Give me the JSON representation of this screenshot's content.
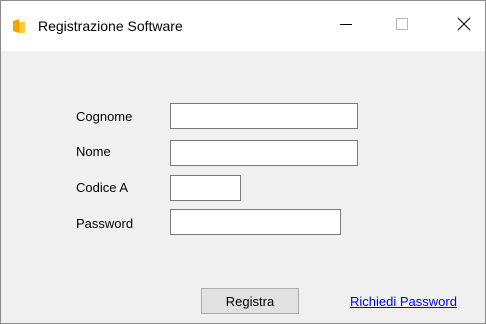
{
  "window": {
    "title": "Registrazione Software",
    "icon": "app-folder-icon",
    "controls": {
      "minimize": "minimize-icon",
      "maximize": "maximize-icon",
      "close": "close-icon"
    }
  },
  "form": {
    "cognome": {
      "label": "Cognome",
      "value": ""
    },
    "nome": {
      "label": "Nome",
      "value": ""
    },
    "codice": {
      "label": "Codice A",
      "value": ""
    },
    "password": {
      "label": "Password",
      "value": ""
    }
  },
  "actions": {
    "register_label": "Registra",
    "request_password_label": "Richiedi Password"
  },
  "colors": {
    "window_bg": "#f0f0f0",
    "titlebar_bg": "#ffffff",
    "link": "#0000ff",
    "button_bg": "#e1e1e1"
  }
}
